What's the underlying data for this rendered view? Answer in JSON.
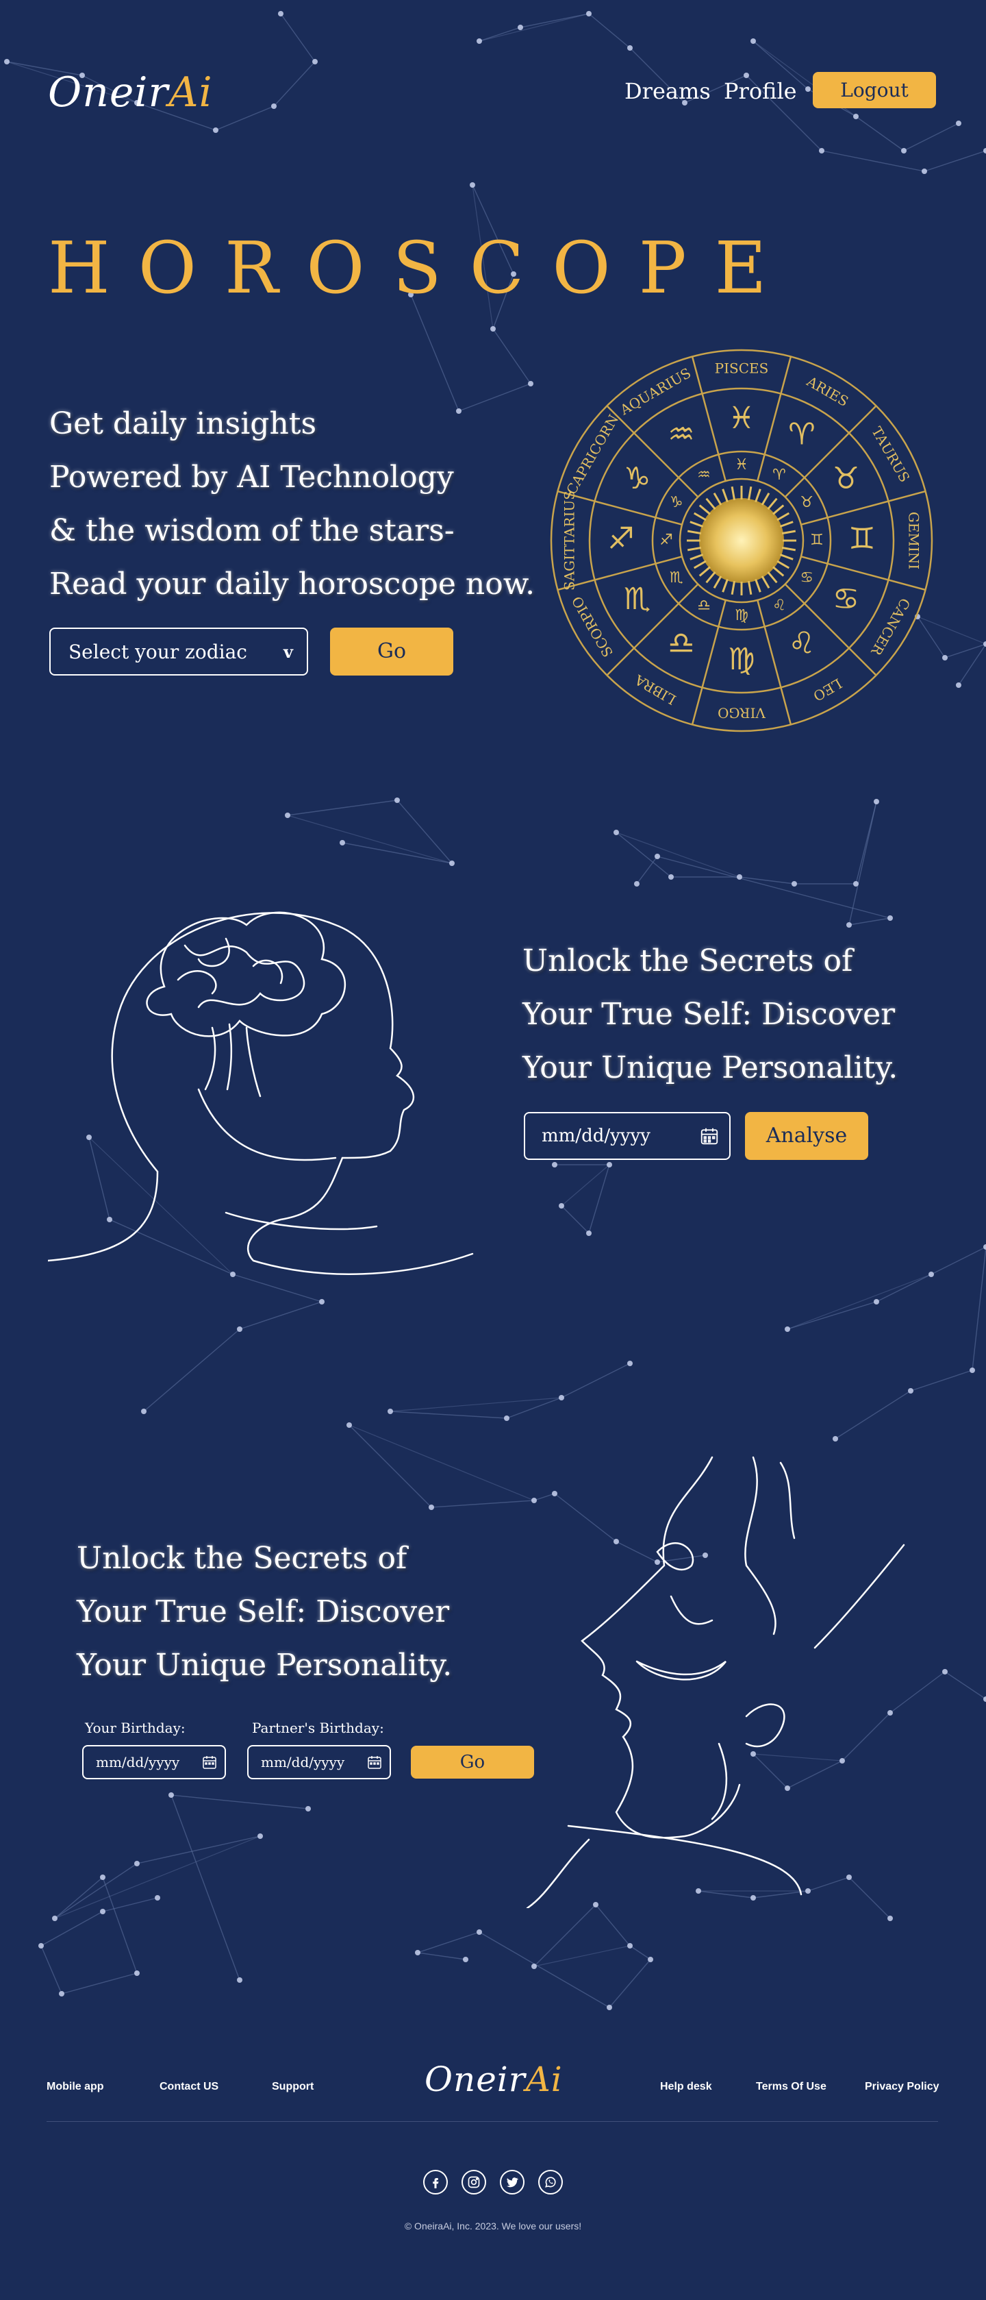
{
  "header": {
    "logo_part1": "Oneir",
    "logo_part2": "Ai",
    "nav": [
      "Dreams",
      "Profile"
    ],
    "logout_label": "Logout"
  },
  "hero": {
    "title": "HOROSCOPE",
    "lines": [
      "Get daily insights",
      "Powered by AI Technology",
      "& the wisdom of the stars-",
      "Read your daily horoscope now."
    ],
    "select_placeholder": "Select your zodiac",
    "select_arrow": "v",
    "go_label": "Go",
    "zodiac_signs": [
      "ARIES",
      "TAURUS",
      "GEMINI",
      "CANCER",
      "LEO",
      "VIRGO",
      "LIBRA",
      "SCORPIO",
      "SAGITTARIUS",
      "CAPRICORN",
      "AQUARIUS",
      "PISCES"
    ],
    "zodiac_symbols": [
      "♈",
      "♉",
      "♊",
      "♋",
      "♌",
      "♍",
      "♎",
      "♏",
      "♐",
      "♑",
      "♒",
      "♓"
    ]
  },
  "personality": {
    "lines": [
      "Unlock the Secrets of",
      "Your True Self: Discover",
      "Your Unique Personality."
    ],
    "date_placeholder": "mm/dd/yyyy",
    "analyse_label": "Analyse"
  },
  "compatibility": {
    "lines": [
      "Unlock the Secrets of",
      "Your True Self: Discover",
      "Your Unique Personality."
    ],
    "your_birthday_label": "Your Birthday:",
    "partner_birthday_label": "Partner's Birthday:",
    "date_placeholder": "mm/dd/yyyy",
    "go_label": "Go"
  },
  "footer": {
    "left_links": [
      "Mobile app",
      "Contact US",
      "Support"
    ],
    "right_links": [
      "Help desk",
      "Terms Of Use",
      "Privacy Policy"
    ],
    "logo_part1": "Oneir",
    "logo_part2": "Ai",
    "social_icons": [
      "facebook-icon",
      "instagram-icon",
      "twitter-icon",
      "whatsapp-icon"
    ],
    "copyright": "© OneiraAi, Inc. 2023. We love our users!"
  },
  "colors": {
    "background": "#1a2c58",
    "accent": "#f2b544",
    "text": "#ffffff"
  }
}
